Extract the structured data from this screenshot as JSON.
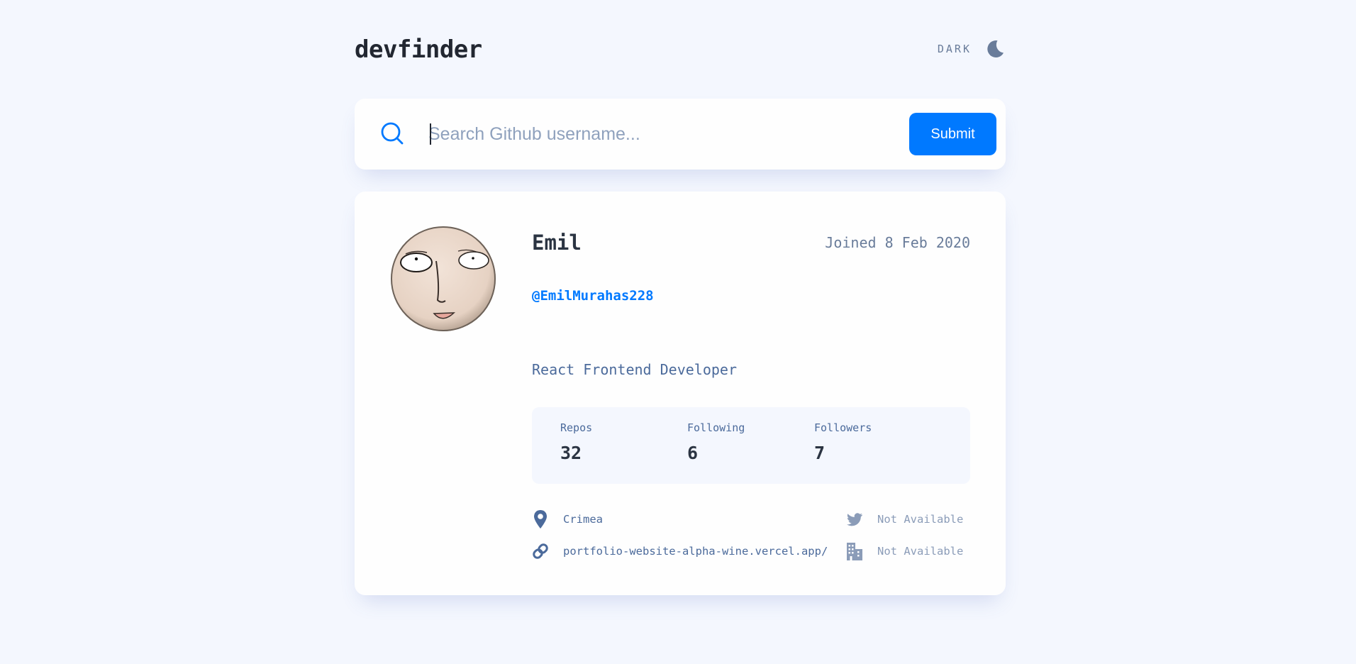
{
  "header": {
    "logo": "devfinder",
    "theme_label": "DARK",
    "theme_icon": "moon-icon"
  },
  "search": {
    "icon": "search-icon",
    "placeholder": "Search Github username...",
    "value": "",
    "submit_label": "Submit"
  },
  "profile": {
    "avatar": "avatar",
    "name": "Emil",
    "joined": "Joined 8 Feb 2020",
    "username": "@EmilMurahas228",
    "bio": "React Frontend Developer",
    "stats": {
      "repos_label": "Repos",
      "repos": "32",
      "following_label": "Following",
      "following": "6",
      "followers_label": "Followers",
      "followers": "7"
    },
    "links": {
      "location": "Crimea",
      "website": "portfolio-website-alpha-wine.vercel.app/",
      "twitter": "Not Available",
      "company": "Not Available"
    }
  },
  "colors": {
    "background": "#f4f7fe",
    "card": "#fefefe",
    "accent": "#0079ff",
    "text_dark": "#2b3442",
    "text_muted": "#697c9a",
    "text_secondary": "#4b6a9b"
  }
}
